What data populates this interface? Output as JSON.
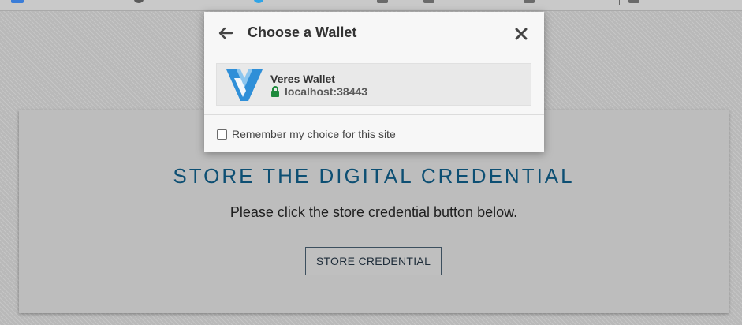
{
  "modal": {
    "title": "Choose a Wallet",
    "wallets": [
      {
        "name": "Veres Wallet",
        "origin": "localhost:38443"
      }
    ],
    "remember_label": "Remember my choice for this site",
    "remember_checked": false
  },
  "page": {
    "title": "STORE THE DIGITAL CREDENTIAL",
    "instruction": "Please click the store credential button below.",
    "store_button_label": "STORE CREDENTIAL"
  },
  "colors": {
    "accent_title": "#0d4f73",
    "logo_blue": "#2f8fd8",
    "lock_green": "#1e8a3c"
  },
  "icons": {
    "back": "arrow-left-icon",
    "close": "close-icon",
    "lock": "lock-icon",
    "logo": "veres-wallet-logo"
  }
}
